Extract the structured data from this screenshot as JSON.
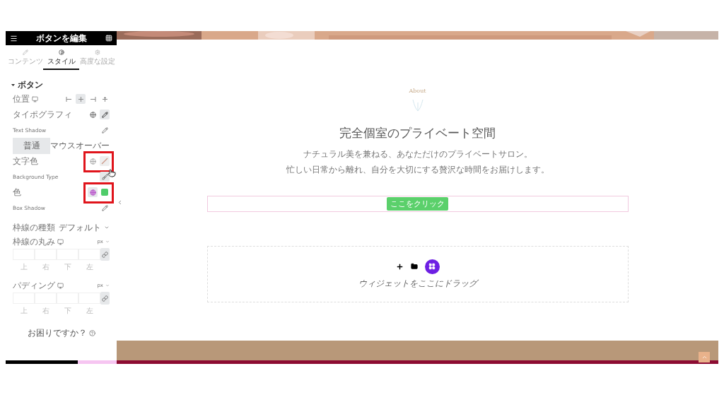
{
  "panel": {
    "title": "ボタンを編集",
    "tabs": [
      {
        "label": "コンテンツ",
        "selected": false
      },
      {
        "label": "スタイル",
        "selected": true
      },
      {
        "label": "高度な設定",
        "selected": false
      }
    ],
    "section": {
      "label": "ボタン",
      "expanded": true
    },
    "rows": [
      {
        "kind": "align",
        "label": "位置",
        "options": [
          {
            "selected": false
          },
          {
            "selected": true
          },
          {
            "selected": false
          },
          {
            "selected": false
          }
        ]
      },
      {
        "kind": "typography",
        "label": "タイポグラフィ"
      },
      {
        "kind": "edit",
        "label": "Text Shadow"
      },
      {
        "kind": "state-tabs",
        "tabs": [
          {
            "label": "普通",
            "selected": true
          },
          {
            "label": "マウスオーバー",
            "selected": false
          }
        ]
      },
      {
        "kind": "color",
        "label": "文字色",
        "global_active": false,
        "highlighted": true
      },
      {
        "kind": "bgtype",
        "label": "Background Type"
      },
      {
        "kind": "color",
        "label": "色",
        "global_active": true,
        "color": "#4fcc6a",
        "highlighted": true
      },
      {
        "kind": "edit",
        "label": "Box Shadow"
      },
      {
        "kind": "select",
        "label": "枠線の種類",
        "value": "デフォルト"
      },
      {
        "kind": "dimensions",
        "label": "枠線の丸み",
        "unit": "px",
        "sides": [
          "上",
          "右",
          "下",
          "左"
        ]
      },
      {
        "kind": "dimensions",
        "label": "パディング",
        "unit": "px",
        "sides": [
          "上",
          "右",
          "下",
          "左"
        ]
      }
    ],
    "help": "お困りですか？"
  },
  "canvas": {
    "eyebrow": "About",
    "heading": "完全個室のプライベート空間",
    "paragraphs": [
      "ナチュラル美を兼ねる、あなただけのプライベートサロン。",
      "忙しい日常から離れ、自分を大切にする贅沢な時間をお届けします。"
    ],
    "button": "ここをクリック",
    "dropzone": "ウィジェットをここにドラッグ"
  }
}
